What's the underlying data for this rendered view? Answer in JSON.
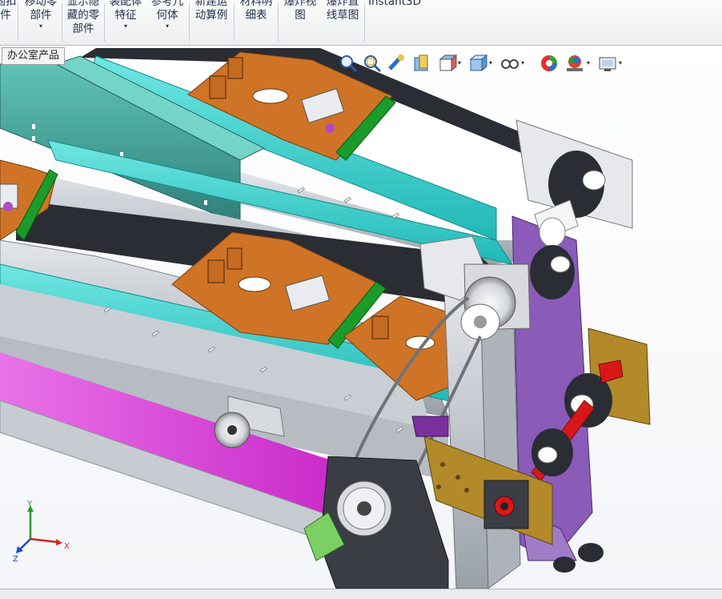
{
  "ribbon": {
    "buttons": [
      {
        "label_lines": [
          "固扣",
          "件"
        ],
        "has_dropdown": false
      },
      {
        "label_lines": [
          "移动零",
          "部件"
        ],
        "has_dropdown": true
      },
      {
        "label_lines": [
          "显示隐",
          "藏的零",
          "部件"
        ],
        "has_dropdown": false
      },
      {
        "label_lines": [
          "装配体",
          "特征"
        ],
        "has_dropdown": true
      },
      {
        "label_lines": [
          "参考几",
          "何体"
        ],
        "has_dropdown": true
      },
      {
        "label_lines": [
          "新建运",
          "动算例"
        ],
        "has_dropdown": false
      },
      {
        "label_lines": [
          "材料明",
          "细表"
        ],
        "has_dropdown": false
      },
      {
        "label_lines": [
          "爆炸视",
          "图"
        ],
        "has_dropdown": false
      },
      {
        "label_lines": [
          "爆炸直",
          "线草图"
        ],
        "has_dropdown": false
      },
      {
        "label_lines": [
          "Instant3D"
        ],
        "has_dropdown": false
      }
    ]
  },
  "feature_tab": {
    "label": "办公室产品"
  },
  "view_toolbar": {
    "icons": [
      "zoom-to-fit-icon",
      "zoom-to-area-icon",
      "previous-view-icon",
      "section-view-icon",
      "view-orientation-icon",
      "display-style-icon",
      "hide-show-items-icon",
      "edit-appearance-icon",
      "apply-scene-icon",
      "view-settings-icon"
    ]
  },
  "triad": {
    "axes": [
      "Y",
      "X",
      "Z"
    ]
  },
  "colors": {
    "aluminum": "#c7ccd3",
    "cyan_cover": "#29c9c6",
    "teal_cover": "#3f9e92",
    "orange_plate": "#cf7426",
    "green_block": "#1a9b2a",
    "magenta_panel": "#d63bd8",
    "purple_frame": "#8a5bb8",
    "dark_belt": "#2a2d33",
    "red_shaft": "#d81818",
    "bronze_plate": "#b28a2a"
  }
}
